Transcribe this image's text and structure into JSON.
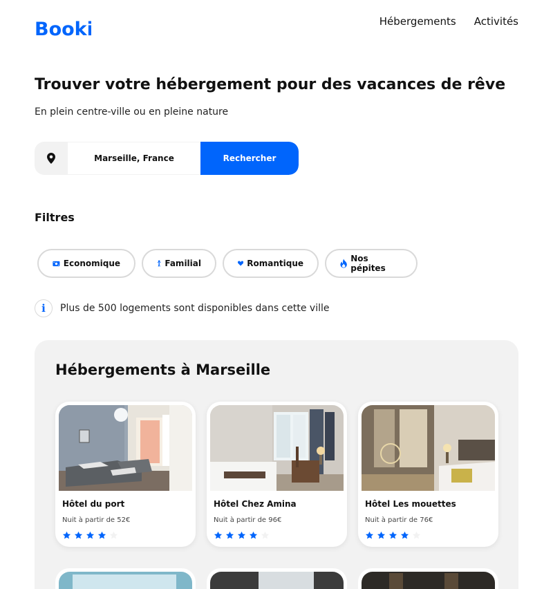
{
  "header": {
    "logo": "Booki",
    "nav": [
      {
        "label": "Hébergements"
      },
      {
        "label": "Activités"
      }
    ]
  },
  "hero": {
    "title": "Trouver votre hébergement pour des vacances de rêve",
    "subtitle": "En plein centre-ville ou en pleine nature"
  },
  "search": {
    "value": "Marseille, France",
    "button_label": "Rechercher",
    "icon": "map-pin-icon"
  },
  "filters": {
    "title": "Filtres",
    "items": [
      {
        "label": "Economique",
        "icon": "money-icon"
      },
      {
        "label": "Familial",
        "icon": "child-icon"
      },
      {
        "label": "Romantique",
        "icon": "heart-icon"
      },
      {
        "label": "Nos pépites",
        "icon": "fire-icon"
      }
    ]
  },
  "info": {
    "icon": "info-icon",
    "text": "Plus de 500 logements sont disponibles dans cette ville"
  },
  "listings": {
    "title": "Hébergements à Marseille",
    "cards": [
      {
        "name": "Hôtel du port",
        "price": "Nuit à partir de 52€",
        "rating": 4,
        "max_rating": 5
      },
      {
        "name": "Hôtel Chez Amina",
        "price": "Nuit à partir de 96€",
        "rating": 4,
        "max_rating": 5
      },
      {
        "name": "Hôtel Les mouettes",
        "price": "Nuit à partir de 76€",
        "rating": 4,
        "max_rating": 5
      }
    ]
  },
  "colors": {
    "accent": "#0065fc",
    "section_bg": "#f2f2f2",
    "star_off": "#f2f2f2"
  }
}
